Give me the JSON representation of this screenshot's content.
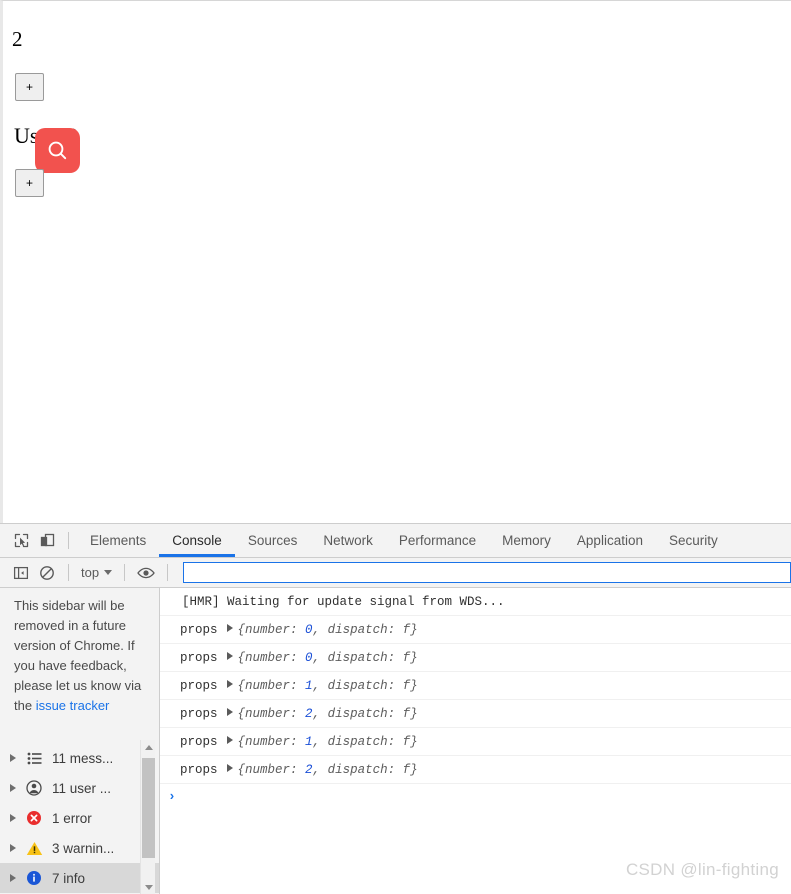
{
  "page": {
    "counter_value": "2",
    "increment_label_1": "+",
    "user_label": "User: 2",
    "increment_label_2": "+",
    "search_badge_color": "#f2524e"
  },
  "devtools": {
    "tabs": [
      {
        "label": "Elements",
        "active": false
      },
      {
        "label": "Console",
        "active": true
      },
      {
        "label": "Sources",
        "active": false
      },
      {
        "label": "Network",
        "active": false
      },
      {
        "label": "Performance",
        "active": false
      },
      {
        "label": "Memory",
        "active": false
      },
      {
        "label": "Application",
        "active": false
      },
      {
        "label": "Security",
        "active": false
      }
    ],
    "active_tab_underline_color": "#1a73e8",
    "toolbar": {
      "inspect_icon": "inspect-element-icon",
      "device_icon": "device-toolbar-icon"
    },
    "console_toolbar": {
      "sidebar_toggle_icon": "sidebar-toggle-icon",
      "clear_icon": "clear-console-icon",
      "context_value": "top",
      "eye_icon": "live-expression-eye-icon",
      "filter_placeholder": "",
      "filter_value": "",
      "filter_focus_color": "#1a73e8"
    },
    "sidebar": {
      "notice_text": "This sidebar will be removed in a future version of Chrome. If you have feedback, please let us know via the ",
      "notice_link": "issue tracker",
      "items": [
        {
          "label": "11 mess...",
          "icon": "list-icon",
          "selected": false
        },
        {
          "label": "11 user ...",
          "icon": "user-icon",
          "selected": false
        },
        {
          "label": "1 error",
          "icon": "error-icon",
          "selected": false
        },
        {
          "label": "3 warnin...",
          "icon": "warning-icon",
          "selected": false
        },
        {
          "label": "7 info",
          "icon": "info-icon",
          "selected": true
        }
      ]
    },
    "messages": [
      {
        "type": "plain",
        "text": "[HMR] Waiting for update signal from WDS..."
      },
      {
        "type": "object",
        "label": "props",
        "open": "{",
        "key": "number: ",
        "number": "0",
        "sep": ", ",
        "fn_key": "dispatch: ",
        "fn": "f",
        "close": "}"
      },
      {
        "type": "object",
        "label": "props",
        "open": "{",
        "key": "number: ",
        "number": "0",
        "sep": ", ",
        "fn_key": "dispatch: ",
        "fn": "f",
        "close": "}"
      },
      {
        "type": "object",
        "label": "props",
        "open": "{",
        "key": "number: ",
        "number": "1",
        "sep": ", ",
        "fn_key": "dispatch: ",
        "fn": "f",
        "close": "}"
      },
      {
        "type": "object",
        "label": "props",
        "open": "{",
        "key": "number: ",
        "number": "2",
        "sep": ", ",
        "fn_key": "dispatch: ",
        "fn": "f",
        "close": "}"
      },
      {
        "type": "object",
        "label": "props",
        "open": "{",
        "key": "number: ",
        "number": "1",
        "sep": ", ",
        "fn_key": "dispatch: ",
        "fn": "f",
        "close": "}"
      },
      {
        "type": "object",
        "label": "props",
        "open": "{",
        "key": "number: ",
        "number": "2",
        "sep": ", ",
        "fn_key": "dispatch: ",
        "fn": "f",
        "close": "}"
      }
    ],
    "prompt_caret": "›"
  },
  "watermark": "CSDN @lin-fighting"
}
